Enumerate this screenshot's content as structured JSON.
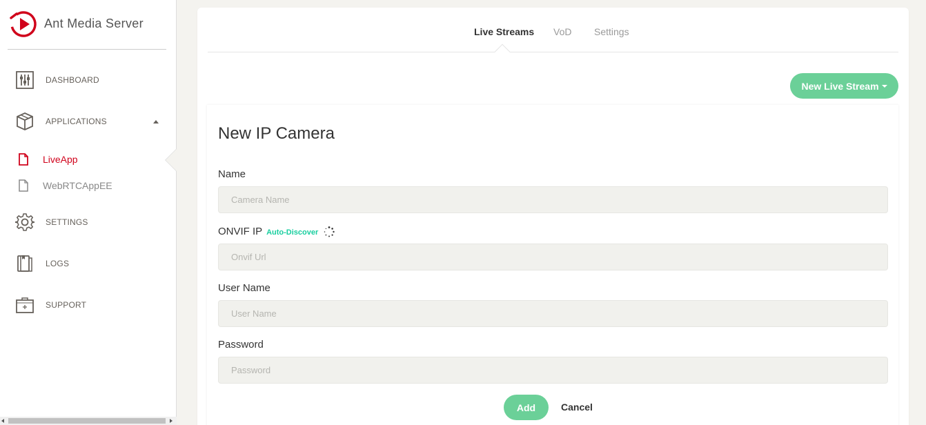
{
  "app": {
    "name": "Ant Media Server",
    "logo_icon": "ant-media-logo",
    "brand_color": "#d0021b"
  },
  "sidebar": {
    "items": [
      {
        "label": "DASHBOARD",
        "icon": "sliders-icon"
      },
      {
        "label": "APPLICATIONS",
        "icon": "cube-icon",
        "expanded": true
      },
      {
        "label": "SETTINGS",
        "icon": "gear-icon"
      },
      {
        "label": "LOGS",
        "icon": "document-icon"
      },
      {
        "label": "SUPPORT",
        "icon": "first-aid-icon"
      }
    ],
    "applications": [
      {
        "label": "LiveApp",
        "active": true
      },
      {
        "label": "WebRTCAppEE",
        "active": false
      }
    ]
  },
  "tabs": [
    {
      "label": "Live Streams",
      "active": true
    },
    {
      "label": "VoD",
      "active": false
    },
    {
      "label": "Settings",
      "active": false
    }
  ],
  "new_stream_button": {
    "label": "New Live Stream",
    "color": "#6bd098"
  },
  "form": {
    "title": "New IP Camera",
    "fields": [
      {
        "label": "Name",
        "placeholder": "Camera Name",
        "value": ""
      },
      {
        "label": "ONVIF IP",
        "placeholder": "Onvif Url",
        "value": ""
      },
      {
        "label": "User Name",
        "placeholder": "User Name",
        "value": ""
      },
      {
        "label": "Password",
        "placeholder": "Password",
        "value": ""
      }
    ],
    "auto_discover_label": "Auto-Discover",
    "add_label": "Add",
    "cancel_label": "Cancel"
  }
}
